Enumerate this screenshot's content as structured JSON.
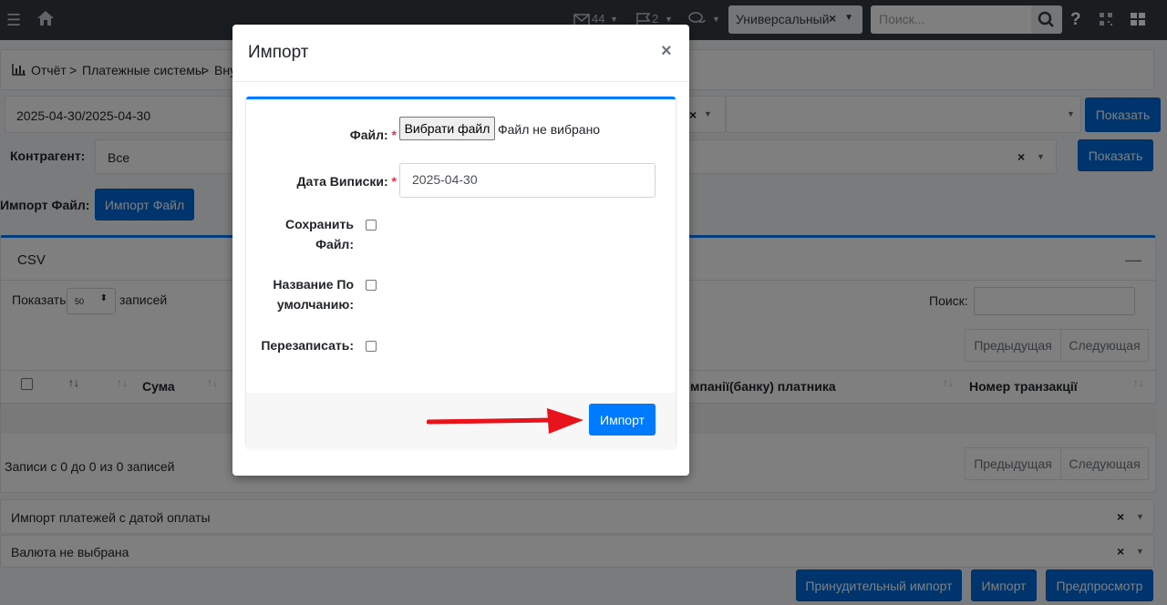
{
  "navbar": {
    "mail_count": "44",
    "flag_count": "2",
    "universal_select": "Универсальный",
    "search_placeholder": "Поиск..."
  },
  "breadcrumb": {
    "item1": "Отчёт",
    "sep": ">",
    "item2": "Платежные системы",
    "item3": "Вну"
  },
  "filters": {
    "date_range": "2025-04-30/2025-04-30",
    "show_label": "Показать",
    "contractor_label": "Контрагент:",
    "contractor_value": "Все",
    "import_file_label": "Импорт Файл:",
    "import_file_button": "Импорт Файл"
  },
  "table_card": {
    "title": "CSV",
    "show_prefix": "Показать",
    "page_size": "50",
    "show_suffix": "записей",
    "search_label": "Поиск:",
    "prev": "Предыдущая",
    "next": "Следующая",
    "columns": {
      "sum": "Сума",
      "payer_bank": "мпанії(банку) платника",
      "transaction_number": "Номер транзакції"
    },
    "info": "Записи с 0 до 0 из 0 записей"
  },
  "bottom": {
    "select1": "Импорт платежей с датой оплаты",
    "select2": "Валюта не выбрана",
    "forced_import": "Принудительный импорт",
    "import": "Импорт",
    "preview": "Предпросмотр"
  },
  "modal": {
    "title": "Импорт",
    "close": "×",
    "file_label": "Файл:",
    "required_mark": "*",
    "file_button": "Вибрати файл",
    "file_status": "Файл не вибрано",
    "statement_date_label": "Дата Виписки:",
    "statement_date_value": "2025-04-30",
    "save_file_label_1": "Сохранить",
    "save_file_label_2": "Файл:",
    "default_name_label_1": "Название По",
    "default_name_label_2": "умолчанию:",
    "overwrite_label": "Перезаписать:",
    "import_button": "Импорт"
  },
  "colors": {
    "primary": "#007bff",
    "navbar": "#343a40",
    "arrow": "#e8141b"
  }
}
